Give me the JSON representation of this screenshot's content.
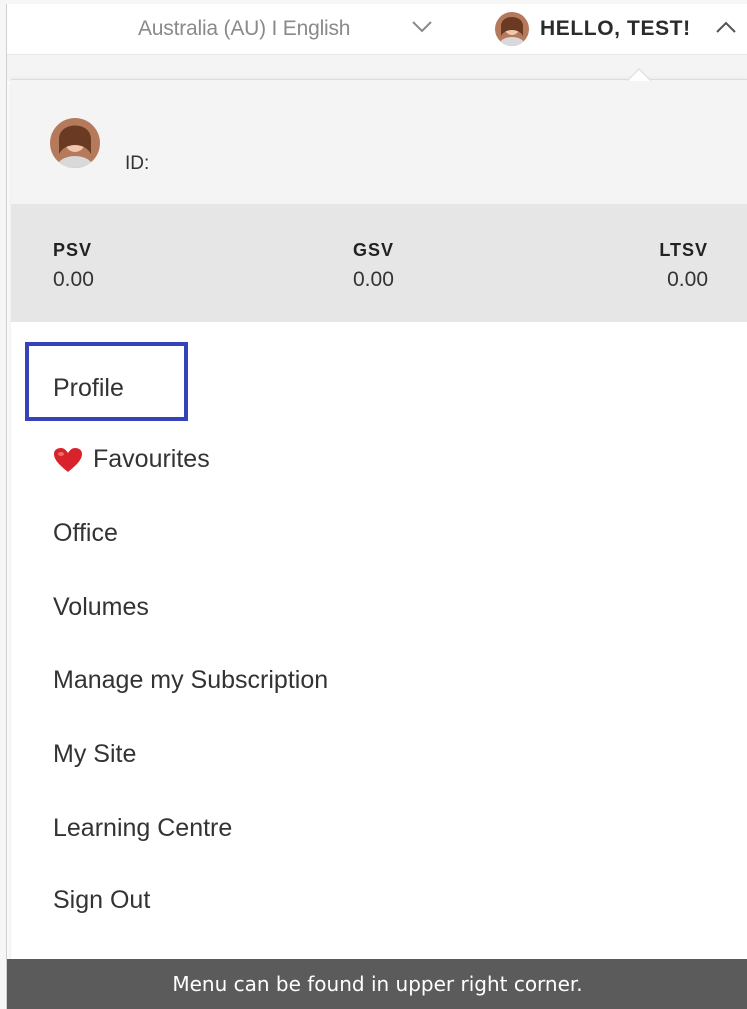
{
  "header": {
    "region_label": "Australia (AU) I English",
    "region_chevron_icon": "chevron-down-icon",
    "greeting": "HELLO, TEST!",
    "greeting_chevron_icon": "chevron-up-icon",
    "avatar_icon": "user-avatar"
  },
  "account": {
    "id_label": "ID:",
    "stats": [
      {
        "label": "PSV",
        "value": "0.00"
      },
      {
        "label": "GSV",
        "value": "0.00"
      },
      {
        "label": "LTSV",
        "value": "0.00"
      }
    ]
  },
  "menu": {
    "items": [
      {
        "label": "Profile"
      },
      {
        "label": "Favourites",
        "icon": "heart-icon"
      },
      {
        "label": "Office"
      },
      {
        "label": "Volumes"
      },
      {
        "label": "Manage my Subscription"
      },
      {
        "label": "My Site"
      },
      {
        "label": "Learning Centre"
      },
      {
        "label": "Sign Out"
      }
    ]
  },
  "caption": "Menu can be found in upper right corner.",
  "colors": {
    "highlight": "#3444b8",
    "caption_bg": "#5b5b5b",
    "stats_bg": "#e6e6e6",
    "heart": "#d8232a"
  }
}
